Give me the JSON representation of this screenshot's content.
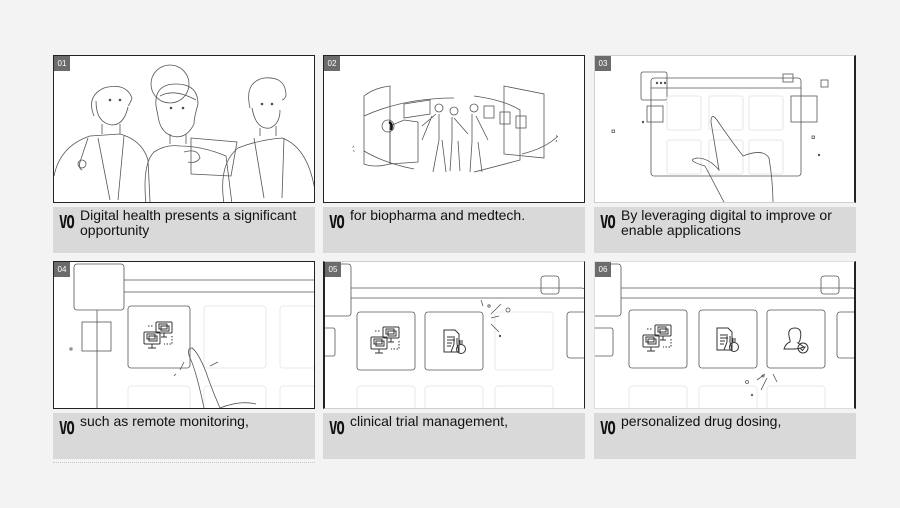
{
  "storyboard": {
    "vo_label": "VO",
    "panels": [
      {
        "number": "01",
        "scene": "three-doctors-with-tablet",
        "caption": "Digital health presents a significant opportunity"
      },
      {
        "number": "02",
        "scene": "team-with-circular-screens",
        "caption": "for biopharma and medtech."
      },
      {
        "number": "03",
        "scene": "finger-tapping-app-grid",
        "caption": "By leveraging digital to improve or enable applications"
      },
      {
        "number": "04",
        "scene": "remote-monitoring-icon-tap",
        "caption": "such as remote monitoring,"
      },
      {
        "number": "05",
        "scene": "clinical-trial-icon-appears",
        "caption": "clinical trial management,"
      },
      {
        "number": "06",
        "scene": "drug-dosing-icon-appears",
        "caption": "personalized drug dosing,"
      }
    ],
    "icons": {
      "remote_monitoring": "monitor-pair-icon",
      "clinical_trial": "document-flask-icon",
      "drug_dosing": "person-check-icon"
    },
    "colors": {
      "background": "#f3f3f3",
      "frame": "#ffffff",
      "caption": "#d9d9d9",
      "badge": "#6b6b6b",
      "line_art": "#555555"
    }
  }
}
